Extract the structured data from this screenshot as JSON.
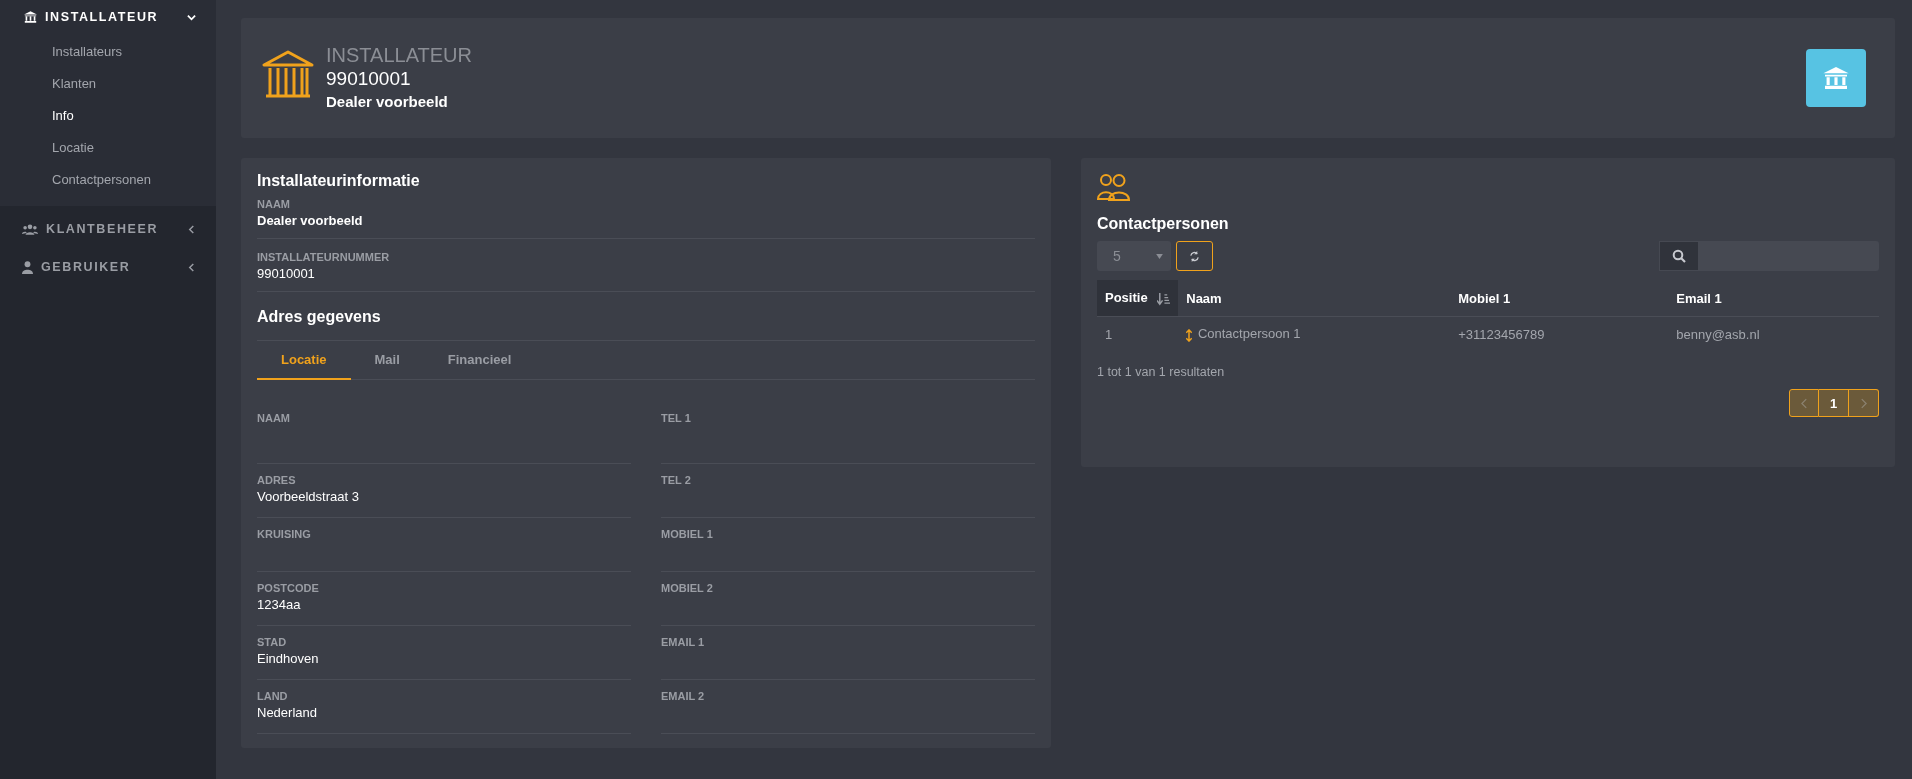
{
  "sidebar": {
    "sections": [
      {
        "label": "INSTALLATEUR",
        "kind": "bank",
        "expanded": true,
        "items": [
          {
            "label": "Installateurs",
            "selected": false
          },
          {
            "label": "Klanten",
            "selected": false
          },
          {
            "label": "Info",
            "selected": true
          },
          {
            "label": "Locatie",
            "selected": false
          },
          {
            "label": "Contactpersonen",
            "selected": false
          }
        ]
      },
      {
        "label": "KLANTBEHEER",
        "kind": "users",
        "expanded": false
      },
      {
        "label": "GEBRUIKER",
        "kind": "user",
        "expanded": false
      }
    ]
  },
  "header": {
    "label": "INSTALLATEUR",
    "number": "99010001",
    "name": "Dealer voorbeeld"
  },
  "info": {
    "title": "Installateurinformatie",
    "fields": [
      {
        "label": "NAAM",
        "value": "Dealer voorbeeld",
        "bold": true
      },
      {
        "label": "INSTALLATEURNUMMER",
        "value": "99010001",
        "bold": false
      }
    ]
  },
  "address": {
    "title": "Adres gegevens",
    "tabs": [
      {
        "label": "Locatie",
        "selected": true
      },
      {
        "label": "Mail",
        "selected": false
      },
      {
        "label": "Financieel",
        "selected": false
      }
    ],
    "columns": [
      [
        {
          "label": "NAAM"
        },
        {
          "label": "ADRES",
          "value": "Voorbeeldstraat 3"
        },
        {
          "label": "KRUISING"
        },
        {
          "label": "POSTCODE",
          "value": "1234aa"
        },
        {
          "label": "STAD",
          "value": "Eindhoven"
        },
        {
          "label": "LAND",
          "value": "Nederland"
        }
      ],
      [
        {
          "label": "TEL 1"
        },
        {
          "label": "TEL 2"
        },
        {
          "label": "MOBIEL 1"
        },
        {
          "label": "MOBIEL 2"
        },
        {
          "label": "EMAIL 1"
        },
        {
          "label": "EMAIL 2"
        }
      ]
    ]
  },
  "contacts": {
    "title": "Contactpersonen",
    "page_size": "5",
    "columns": [
      {
        "label": "Positie",
        "sorted": true
      },
      {
        "label": "Naam",
        "sorted": false
      },
      {
        "label": "Mobiel 1",
        "sorted": false
      },
      {
        "label": "Email 1",
        "sorted": false
      }
    ],
    "rows": [
      {
        "cells": [
          "1",
          "Contactpersoon 1",
          "+31123456789",
          "benny@asb.nl"
        ]
      }
    ],
    "summary": "1 tot 1 van 1 resultaten",
    "pages": [
      {
        "label": "1",
        "selected": true
      }
    ]
  }
}
